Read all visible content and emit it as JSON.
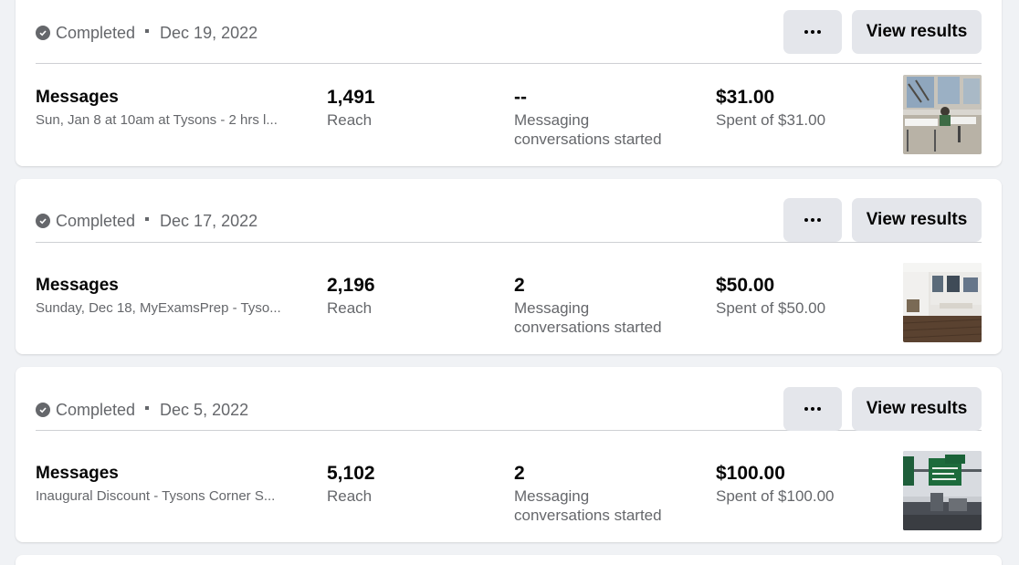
{
  "campaigns": [
    {
      "status": "Completed",
      "date": "Dec 19, 2022",
      "more_label": "More options",
      "view_label": "View results",
      "name": "Messages",
      "description": "Sun, Jan 8 at 10am at Tysons - 2 hrs l...",
      "reach_value": "1,491",
      "reach_label": "Reach",
      "results_value": "--",
      "results_label": "Messaging conversations started",
      "spend_value": "$31.00",
      "spend_label": "Spent of $31.00",
      "thumbnail": "classroom-photo"
    },
    {
      "status": "Completed",
      "date": "Dec 17, 2022",
      "more_label": "More options",
      "view_label": "View results",
      "name": "Messages",
      "description": "Sunday, Dec 18, MyExamsPrep - Tyso...",
      "reach_value": "2,196",
      "reach_label": "Reach",
      "results_value": "2",
      "results_label": "Messaging conversations started",
      "spend_value": "$50.00",
      "spend_label": "Spent of $50.00",
      "thumbnail": "office-photo"
    },
    {
      "status": "Completed",
      "date": "Dec 5, 2022",
      "more_label": "More options",
      "view_label": "View results",
      "name": "Messages",
      "description": "Inaugural Discount - Tysons Corner S...",
      "reach_value": "5,102",
      "reach_label": "Reach",
      "results_value": "2",
      "results_label": "Messaging conversations started",
      "spend_value": "$100.00",
      "spend_label": "Spent of $100.00",
      "thumbnail": "highway-sign-photo"
    }
  ],
  "colors": {
    "page_bg": "#f0f2f5",
    "card_bg": "#ffffff",
    "button_bg": "#e4e6eb",
    "secondary_text": "#65676b",
    "primary_text": "#050505"
  }
}
